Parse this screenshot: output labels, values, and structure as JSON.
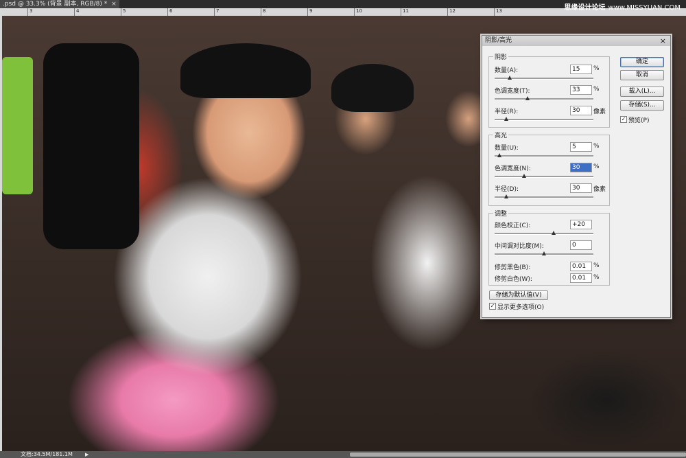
{
  "window": {
    "tab_title": ".psd @ 33.3% (背景 副本, RGB/8) *",
    "tab_close": "×",
    "watermark_brand": "思缘设计论坛",
    "watermark_url": "www.MISSYUAN.COM"
  },
  "ruler": {
    "ticks": [
      "3",
      "4",
      "5",
      "6",
      "7",
      "8",
      "9",
      "10",
      "11",
      "12",
      "13"
    ]
  },
  "status": {
    "doc_info": "文档:34.5M/181.1M",
    "arrow": "▶"
  },
  "dialog": {
    "title": "阴影/高光",
    "close": "×",
    "shadows": {
      "label": "阴影",
      "amount_label": "数量(A):",
      "amount_value": "15",
      "amount_unit": "%",
      "amount_level": 0.15,
      "tonal_label": "色调宽度(T):",
      "tonal_value": "33",
      "tonal_unit": "%",
      "tonal_level": 0.33,
      "radius_label": "半径(R):",
      "radius_value": "30",
      "radius_unit": "像素",
      "radius_level": 0.12
    },
    "highlights": {
      "label": "高光",
      "amount_label": "数量(U):",
      "amount_value": "5",
      "amount_unit": "%",
      "amount_level": 0.05,
      "tonal_label": "色调宽度(N):",
      "tonal_value": "30",
      "tonal_unit": "%",
      "tonal_level": 0.3,
      "radius_label": "半径(D):",
      "radius_value": "30",
      "radius_unit": "像素",
      "radius_level": 0.12
    },
    "adjust": {
      "label": "调整",
      "color_label": "颜色校正(C):",
      "color_value": "+20",
      "color_level": 0.6,
      "contrast_label": "中间调对比度(M):",
      "contrast_value": "0",
      "contrast_level": 0.5,
      "black_label": "修剪黑色(B):",
      "black_value": "0.01",
      "black_unit": "%",
      "white_label": "修剪白色(W):",
      "white_value": "0.01",
      "white_unit": "%"
    },
    "buttons": {
      "ok": "确定",
      "cancel": "取消",
      "load": "载入(L)...",
      "save": "存储(S)...",
      "preview": "预览(P)",
      "save_default": "存储为默认值(V)",
      "more_options": "显示更多选项(O)"
    },
    "check_mark": "✓"
  }
}
